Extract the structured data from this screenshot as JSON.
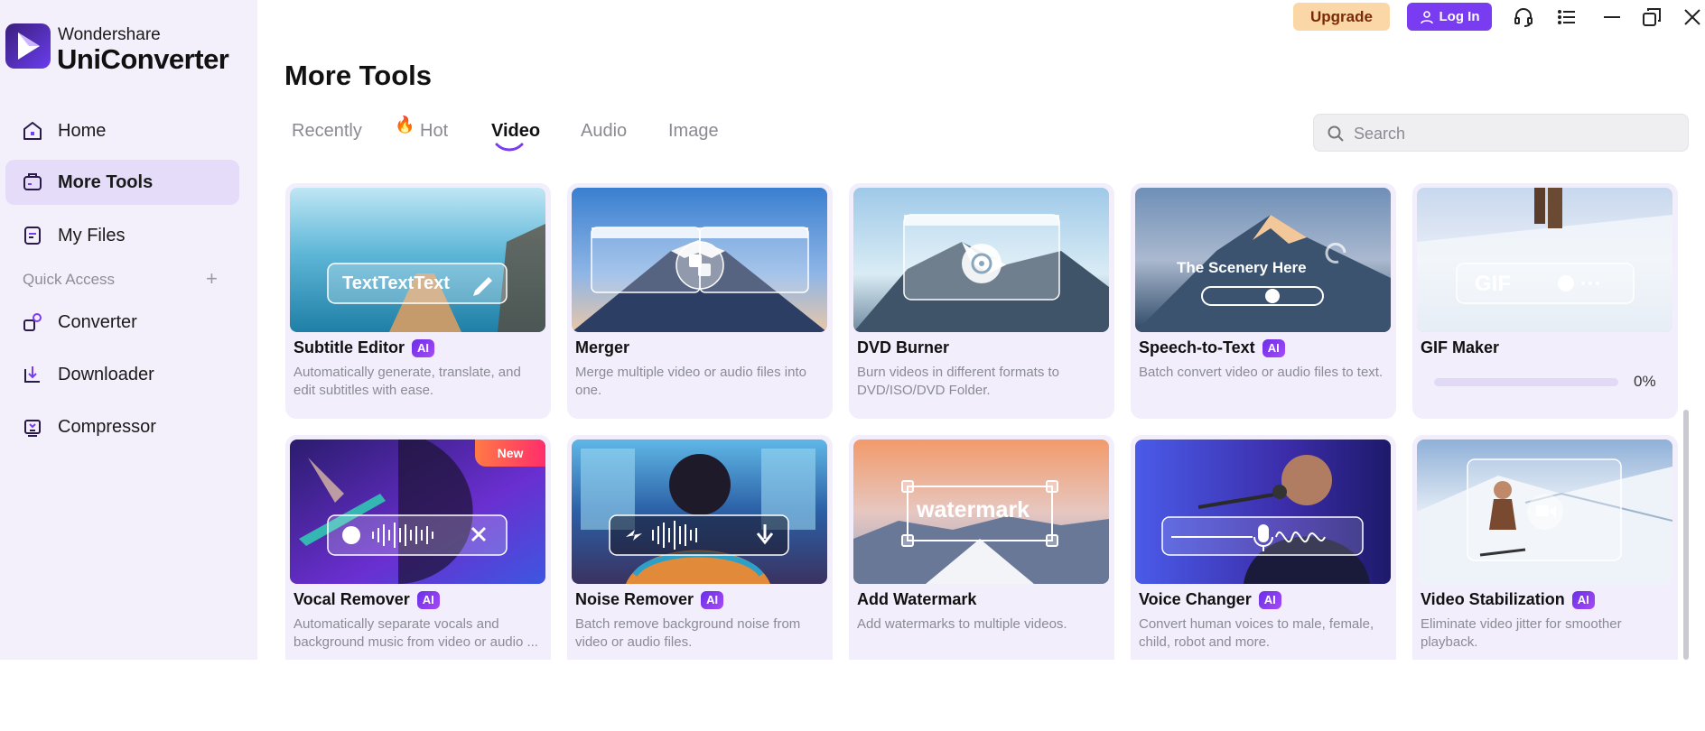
{
  "brand": {
    "company": "Wondershare",
    "product": "UniConverter"
  },
  "sidebar": {
    "items": [
      {
        "label": "Home",
        "icon": "home-icon"
      },
      {
        "label": "More Tools",
        "icon": "toolbox-icon",
        "active": true
      },
      {
        "label": "My Files",
        "icon": "file-icon"
      }
    ],
    "quick_access_label": "Quick Access",
    "quick_access_add": "+",
    "quick_items": [
      {
        "label": "Converter",
        "icon": "converter-icon"
      },
      {
        "label": "Downloader",
        "icon": "downloader-icon"
      },
      {
        "label": "Compressor",
        "icon": "compressor-icon"
      }
    ]
  },
  "topbar": {
    "upgrade_label": "Upgrade",
    "login_label": "Log In"
  },
  "page": {
    "title": "More Tools"
  },
  "tabs": [
    {
      "label": "Recently"
    },
    {
      "label": "Hot",
      "icon": "fire-icon"
    },
    {
      "label": "Video",
      "active": true
    },
    {
      "label": "Audio"
    },
    {
      "label": "Image"
    }
  ],
  "search": {
    "placeholder": "Search"
  },
  "cards": [
    {
      "title": "Subtitle Editor",
      "ai": true,
      "ai_label": "AI",
      "desc": "Automatically generate, translate, and edit subtitles with ease.",
      "thumb_text": "TextTextText"
    },
    {
      "title": "Merger",
      "ai": false,
      "desc": "Merge multiple video or audio files into one."
    },
    {
      "title": "DVD Burner",
      "ai": false,
      "desc": "Burn videos in different formats to DVD/ISO/DVD Folder."
    },
    {
      "title": "Speech-to-Text",
      "ai": true,
      "ai_label": "AI",
      "desc": "Batch convert video or audio files to text.",
      "thumb_text": "The Scenery Here"
    },
    {
      "title": "GIF Maker",
      "ai": false,
      "progress": 0,
      "progress_label": "0%",
      "thumb_text": "GIF"
    },
    {
      "title": "Vocal Remover",
      "ai": true,
      "ai_label": "AI",
      "badge": "New",
      "desc": "Automatically separate vocals and background music from video or audio ..."
    },
    {
      "title": "Noise Remover",
      "ai": true,
      "ai_label": "AI",
      "desc": "Batch remove background noise from video or audio files."
    },
    {
      "title": "Add Watermark",
      "ai": false,
      "desc": "Add watermarks to multiple videos.",
      "thumb_text": "watermark"
    },
    {
      "title": "Voice Changer",
      "ai": true,
      "ai_label": "AI",
      "desc": "Convert human voices to male, female, child, robot and more."
    },
    {
      "title": "Video Stabilization",
      "ai": true,
      "ai_label": "AI",
      "desc": "Eliminate video jitter for smoother playback."
    }
  ],
  "colors": {
    "accent": "#7a3cf0",
    "sidebar_bg": "#f3f0fb",
    "card_bg": "#f2eefc",
    "upgrade_bg": "#fbd7a8"
  }
}
